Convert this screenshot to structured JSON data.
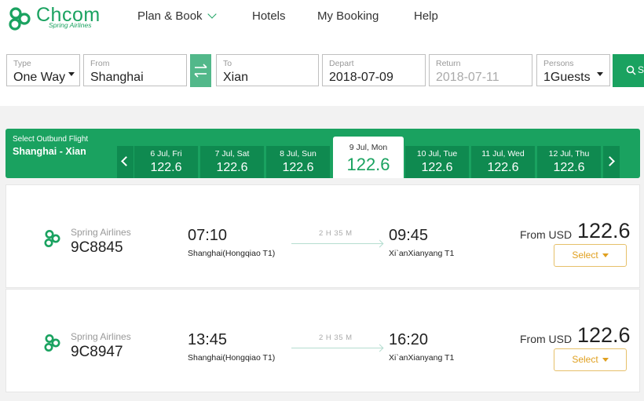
{
  "brand": {
    "name": "Chcom",
    "subtitle": "Spring Airlines",
    "color": "#1aa260"
  },
  "nav": {
    "items": [
      {
        "label": "Plan & Book",
        "has_dropdown": true
      },
      {
        "label": "Hotels"
      },
      {
        "label": "My Booking"
      },
      {
        "label": "Help"
      }
    ]
  },
  "search": {
    "type": {
      "label": "Type",
      "value": "One Way"
    },
    "from": {
      "label": "From",
      "value": "Shanghai"
    },
    "to": {
      "label": "To",
      "value": "Xian"
    },
    "depart": {
      "label": "Depart",
      "value": "2018-07-09"
    },
    "return": {
      "label": "Return",
      "value": "2018-07-11",
      "disabled": true
    },
    "persons": {
      "label": "Persons",
      "value": "1Guests"
    },
    "swap_icon": "swap-arrows-icon",
    "search_icon": "search-icon",
    "search_label": "S"
  },
  "date_strip": {
    "label": "Select Outbund Flight",
    "route": "Shanghai - Xian",
    "days": [
      {
        "date": "6 Jul, Fri",
        "price": "122.6"
      },
      {
        "date": "7 Jul, Sat",
        "price": "122.6"
      },
      {
        "date": "8 Jul, Sun",
        "price": "122.6"
      },
      {
        "date": "9 Jul, Mon",
        "price": "122.6",
        "active": true
      },
      {
        "date": "10 Jul, Tue",
        "price": "122.6"
      },
      {
        "date": "11 Jul, Wed",
        "price": "122.6"
      },
      {
        "date": "12 Jul, Thu",
        "price": "122.6"
      }
    ]
  },
  "flights": [
    {
      "airline": "Spring Airlines",
      "flight_no": "9C8845",
      "dep_time": "07:10",
      "dep_airport": "Shanghai(Hongqiao T1)",
      "duration": "2 H 35 M",
      "arr_time": "09:45",
      "arr_airport": "Xi`anXianyang T1",
      "from_label": "From USD",
      "price": "122.6",
      "select_label": "Select"
    },
    {
      "airline": "Spring Airlines",
      "flight_no": "9C8947",
      "dep_time": "13:45",
      "dep_airport": "Shanghai(Hongqiao T1)",
      "duration": "2 H 35 M",
      "arr_time": "16:20",
      "arr_airport": "Xi`anXianyang T1",
      "from_label": "From USD",
      "price": "122.6",
      "select_label": "Select"
    }
  ]
}
